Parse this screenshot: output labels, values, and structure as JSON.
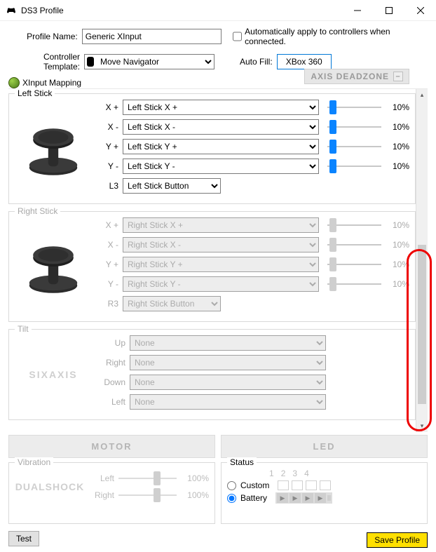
{
  "window": {
    "title": "DS3 Profile"
  },
  "top": {
    "profile_name_label": "Profile Name:",
    "profile_name_value": "Generic XInput",
    "auto_apply_label": "Automatically apply to controllers when connected.",
    "controller_template_label": "Controller Template:",
    "controller_template_value": "Move Navigator",
    "auto_fill_label": "Auto Fill:",
    "auto_fill_button": "XBox 360",
    "tab_label": "XInput Mapping",
    "axis_deadzone_label": "AXIS DEADZONE",
    "axis_deadzone_btn": "–"
  },
  "left_stick": {
    "legend": "Left Stick",
    "rows": [
      {
        "label": "X +",
        "value": "Left Stick X +",
        "pct": "10%"
      },
      {
        "label": "X -",
        "value": "Left Stick X -",
        "pct": "10%"
      },
      {
        "label": "Y +",
        "value": "Left Stick Y +",
        "pct": "10%"
      },
      {
        "label": "Y -",
        "value": "Left Stick Y -",
        "pct": "10%"
      }
    ],
    "l3_label": "L3",
    "l3_value": "Left Stick Button"
  },
  "right_stick": {
    "legend": "Right Stick",
    "rows": [
      {
        "label": "X +",
        "value": "Right Stick X +",
        "pct": "10%"
      },
      {
        "label": "X -",
        "value": "Right Stick X -",
        "pct": "10%"
      },
      {
        "label": "Y +",
        "value": "Right Stick Y +",
        "pct": "10%"
      },
      {
        "label": "Y -",
        "value": "Right Stick Y -",
        "pct": "10%"
      }
    ],
    "r3_label": "R3",
    "r3_value": "Right Stick Button"
  },
  "tilt": {
    "legend": "Tilt",
    "brand": "SIXAXIS",
    "rows": [
      {
        "label": "Up",
        "value": "None"
      },
      {
        "label": "Right",
        "value": "None"
      },
      {
        "label": "Down",
        "value": "None"
      },
      {
        "label": "Left",
        "value": "None"
      }
    ]
  },
  "bigtabs": {
    "motor": "MOTOR",
    "led": "LED"
  },
  "vibration": {
    "legend": "Vibration",
    "brand": "DUALSHOCK",
    "rows": [
      {
        "label": "Left",
        "pct": "100%"
      },
      {
        "label": "Right",
        "pct": "100%"
      }
    ],
    "test": "Test"
  },
  "status": {
    "legend": "Status",
    "nums": [
      "1",
      "2",
      "3",
      "4"
    ],
    "custom": "Custom",
    "battery": "Battery"
  },
  "save": "Save Profile"
}
